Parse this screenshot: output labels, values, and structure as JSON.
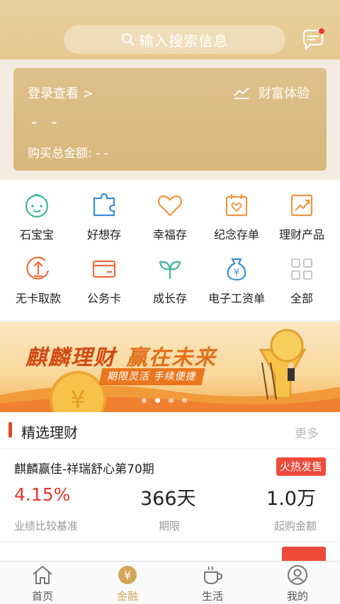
{
  "search": {
    "placeholder": "输入搜索信息"
  },
  "card": {
    "login": "登录查看 >",
    "experience": "财富体验",
    "amount_placeholder": "- -",
    "purchase_total": "购买总金额: - -"
  },
  "grid": {
    "items": [
      {
        "label": "石宝宝",
        "icon": "baby-face-icon"
      },
      {
        "label": "好想存",
        "icon": "puzzle-icon"
      },
      {
        "label": "幸福存",
        "icon": "heart-icon"
      },
      {
        "label": "纪念存单",
        "icon": "calendar-heart-icon"
      },
      {
        "label": "理财产品",
        "icon": "chart-note-icon"
      },
      {
        "label": "无卡取款",
        "icon": "withdraw-icon"
      },
      {
        "label": "公务卡",
        "icon": "card-icon"
      },
      {
        "label": "成长存",
        "icon": "sprout-icon"
      },
      {
        "label": "电子工资单",
        "icon": "money-bag-icon"
      },
      {
        "label": "全部",
        "icon": "grid-icon"
      }
    ]
  },
  "banner": {
    "title_part1": "麒麟理财",
    "title_part2": "赢在未来",
    "subtitle": "期限灵活 手续便捷",
    "dots": 4,
    "active_dot": 1
  },
  "section": {
    "title": "精选理财",
    "more": "更多"
  },
  "product": {
    "name": "麒麟赢佳-祥瑞舒心第70期",
    "badge": "火热发售",
    "rate": "4.15%",
    "rate_label": "业绩比较基准",
    "term": "366天",
    "term_label": "期限",
    "min": "1.0万",
    "min_label": "起购金额"
  },
  "tabs": [
    {
      "label": "首页",
      "icon": "home-icon",
      "active": false
    },
    {
      "label": "金融",
      "icon": "yuan-icon",
      "active": true
    },
    {
      "label": "生活",
      "icon": "coffee-icon",
      "active": false
    },
    {
      "label": "我的",
      "icon": "user-icon",
      "active": false
    }
  ],
  "colors": {
    "gold": "#e6c88f",
    "accent": "#d3a75a",
    "red": "#ee4b3b"
  }
}
